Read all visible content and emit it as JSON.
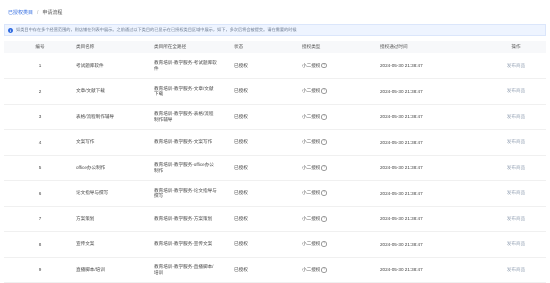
{
  "breadcrumb": {
    "parent": "已授权类目",
    "separator": "/",
    "current": "申请流程"
  },
  "notice": {
    "text": "如类目中存在多个经营范围的，则店铺在列表中展示。之前通过以下类目的已显示在已授权类目区域中展示，如下，多次后将会被提交。请在需要的时候"
  },
  "columns": [
    "编号",
    "类目名称",
    "类目所在全路径",
    "状态",
    "授权类型",
    "授权通过时间",
    "操作"
  ],
  "rows": [
    {
      "num": "1",
      "name": "考试题库软件",
      "path": "教育培训-教学服务-考试题库软件",
      "status": "已授权",
      "type": "小二授权",
      "time": "2024-05-30 21:38:47",
      "op": "发布商品"
    },
    {
      "num": "2",
      "name": "文章/文献下载",
      "path": "教育培训-教学服务-文章/文献下载",
      "status": "已授权",
      "type": "小二授权",
      "time": "2024-05-30 21:38:47",
      "op": "发布商品"
    },
    {
      "num": "3",
      "name": "表格/流程制作辅导",
      "path": "教育培训-教学服务-表格/流程制作辅导",
      "status": "已授权",
      "type": "小二授权",
      "time": "2024-05-30 21:38:47",
      "op": "发布商品"
    },
    {
      "num": "4",
      "name": "文案写作",
      "path": "教育培训-教学服务-文案写作",
      "status": "已授权",
      "type": "小二授权",
      "time": "2024-05-30 21:38:47",
      "op": "发布商品"
    },
    {
      "num": "5",
      "name": "office办公制作",
      "path": "教育培训-教学服务-office办公制作",
      "status": "已授权",
      "type": "小二授权",
      "time": "2024-05-30 21:38:47",
      "op": "发布商品"
    },
    {
      "num": "6",
      "name": "论文指导与撰写",
      "path": "教育培训-教学服务-论文指导与撰写",
      "status": "已授权",
      "type": "小二授权",
      "time": "2024-05-30 21:38:47",
      "op": "发布商品"
    },
    {
      "num": "7",
      "name": "方案策划",
      "path": "教育培训-教学服务-方案策划",
      "status": "已授权",
      "type": "小二授权",
      "time": "2024-05-30 21:38:47",
      "op": "发布商品"
    },
    {
      "num": "8",
      "name": "宣传文案",
      "path": "教育培训-教学服务-宣传文案",
      "status": "已授权",
      "type": "小二授权",
      "time": "2024-05-30 21:38:47",
      "op": "发布商品"
    },
    {
      "num": "9",
      "name": "直播脚本/培训",
      "path": "教育培训-教学服务-直播脚本/培训",
      "status": "已授权",
      "type": "小二授权",
      "time": "2024-05-30 21:38:47",
      "op": "发布商品"
    }
  ],
  "colors": {
    "accent": "#2f6ae0",
    "notice_bg": "#eef4ff",
    "header_bg": "#f7f8fa",
    "op_link": "#9aa7b8"
  }
}
